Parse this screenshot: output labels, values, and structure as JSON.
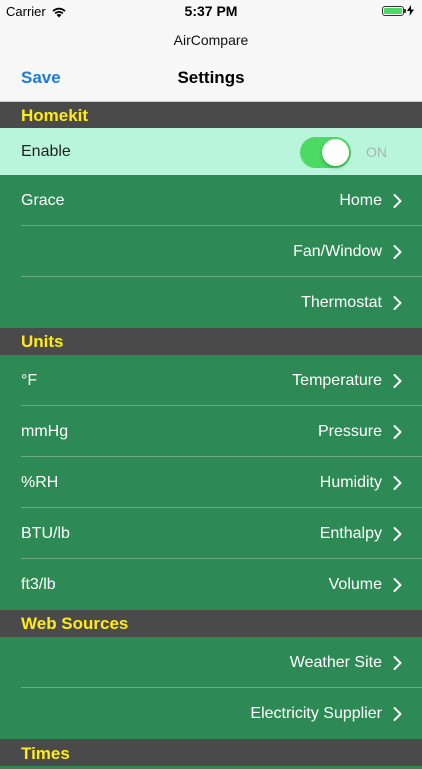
{
  "status_bar": {
    "carrier": "Carrier",
    "time": "5:37 PM",
    "wifi_icon": "wifi-icon",
    "battery_icon": "battery-icon",
    "charging_icon": "bolt-icon",
    "battery_level": 1.0
  },
  "header": {
    "app_title": "AirCompare",
    "save_label": "Save",
    "page_title": "Settings"
  },
  "colors": {
    "save": "#1e7bd6",
    "section_header_bg": "#4a4a4a",
    "section_header_text": "#ffeb1a",
    "row_bg": "#2e8a55",
    "enable_row_bg": "#b9f5da",
    "toggle_on": "#4cd964"
  },
  "sections": {
    "homekit": {
      "title": "Homekit",
      "enable": {
        "label": "Enable",
        "toggle_state": "ON",
        "on": true
      },
      "rows": [
        {
          "label": "Grace",
          "value": "Home"
        },
        {
          "label": "",
          "value": "Fan/Window"
        },
        {
          "label": "",
          "value": "Thermostat"
        }
      ]
    },
    "units": {
      "title": "Units",
      "rows": [
        {
          "label": "°F",
          "value": "Temperature"
        },
        {
          "label": "mmHg",
          "value": "Pressure"
        },
        {
          "label": "%RH",
          "value": "Humidity"
        },
        {
          "label": "BTU/lb",
          "value": "Enthalpy"
        },
        {
          "label": "ft3/lb",
          "value": "Volume"
        }
      ]
    },
    "web_sources": {
      "title": "Web Sources",
      "rows": [
        {
          "label": "",
          "value": "Weather Site"
        },
        {
          "label": "",
          "value": "Electricity Supplier"
        }
      ]
    },
    "times": {
      "title": "Times"
    }
  }
}
